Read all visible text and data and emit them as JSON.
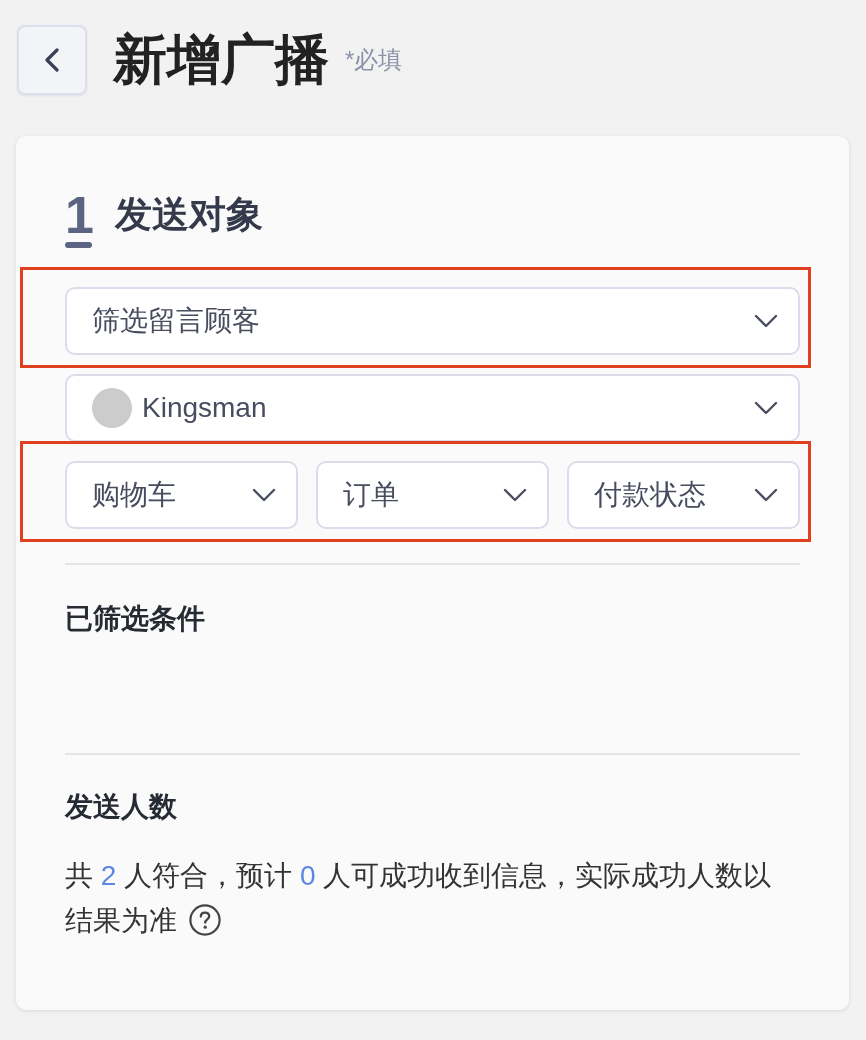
{
  "header": {
    "title": "新增广播",
    "required_note": "*必填"
  },
  "section": {
    "step": "1",
    "title": "发送对象",
    "fields": [
      {
        "kind": "select",
        "value": "筛选留言顾客",
        "highlighted": true
      },
      {
        "kind": "account",
        "value": "Kingsman",
        "highlighted": false
      },
      {
        "kind": "select_row",
        "highlighted": true,
        "items": [
          {
            "value": "购物车"
          },
          {
            "value": "订单"
          },
          {
            "value": "付款状态"
          }
        ]
      }
    ],
    "filtered_conditions": {
      "title": "已筛选条件"
    },
    "recipients": {
      "title": "发送人数",
      "summary": [
        {
          "kind": "text",
          "text": "共 "
        },
        {
          "kind": "count",
          "text": "2"
        },
        {
          "kind": "text",
          "text": " 人符合，预计 "
        },
        {
          "kind": "count",
          "text": "0"
        },
        {
          "kind": "text",
          "text": " 人可成功收到信息，实际成功人数以结果为准"
        }
      ]
    }
  }
}
